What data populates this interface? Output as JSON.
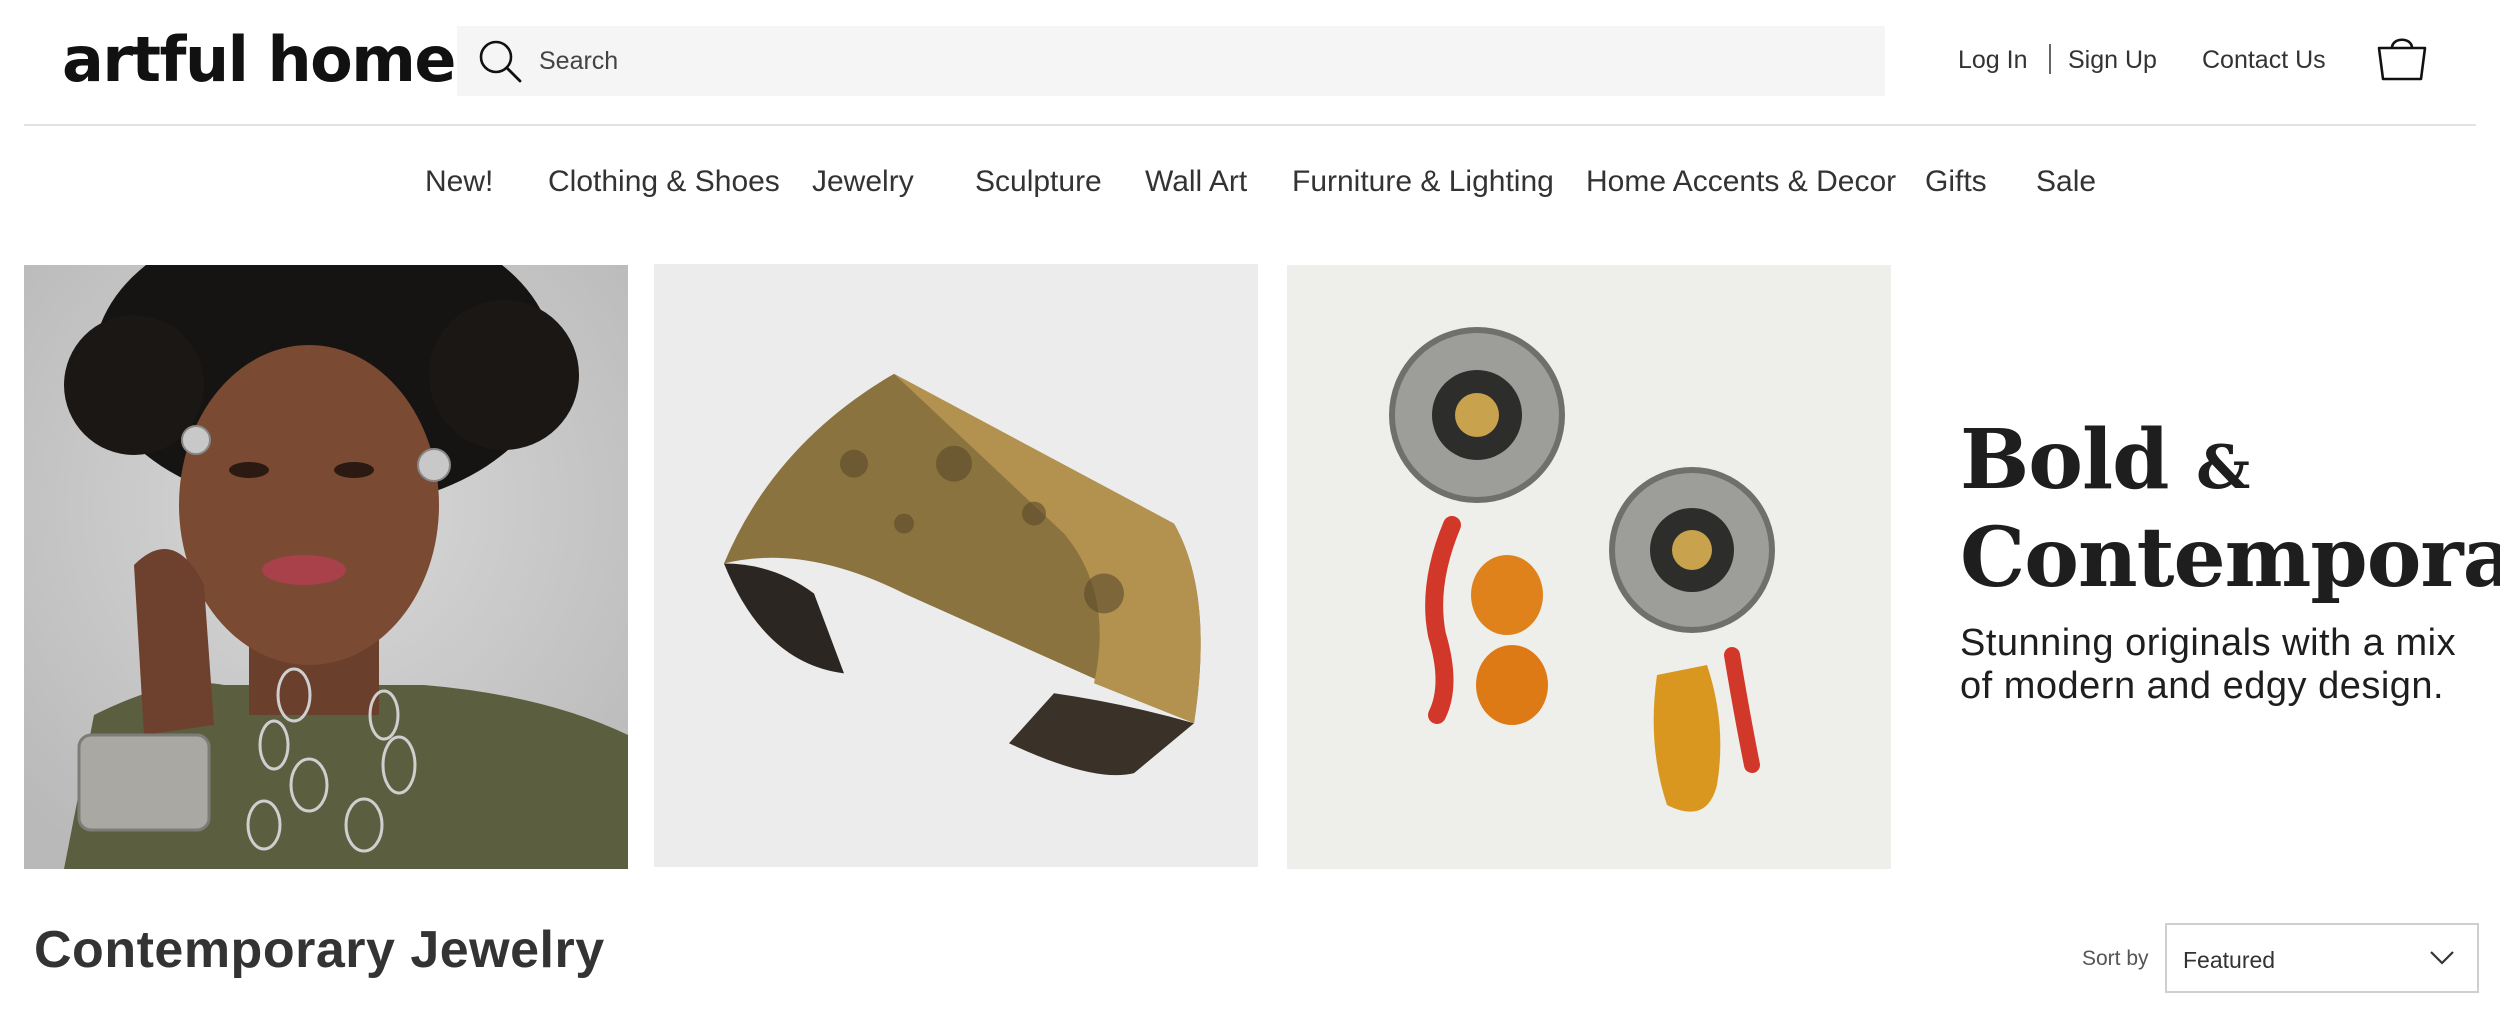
{
  "header": {
    "logo": "artful home",
    "search_placeholder": "Search",
    "links": {
      "login": "Log In",
      "signup": "Sign Up",
      "contact": "Contact Us"
    }
  },
  "nav": {
    "items": [
      "New!",
      "Clothing & Shoes",
      "Jewelry",
      "Sculpture",
      "Wall Art",
      "Furniture & Lighting",
      "Home Accents & Decor",
      "Gifts",
      "Sale"
    ]
  },
  "hero": {
    "title_line1": "Bold",
    "title_amp": "&",
    "title_line2": "Contemporary",
    "subtitle": "Stunning originals with a mix of modern and edgy design."
  },
  "listing": {
    "title": "Contemporary Jewelry",
    "sort_label": "Sort by",
    "sort_value": "Featured"
  },
  "icons": {
    "search": "search-icon",
    "bag": "shopping-bag-icon",
    "sort_chevron": "chevron-down-icon"
  },
  "colors": {
    "text": "#333333",
    "search_bg": "#f5f5f5",
    "rule": "#e2e2e2"
  }
}
